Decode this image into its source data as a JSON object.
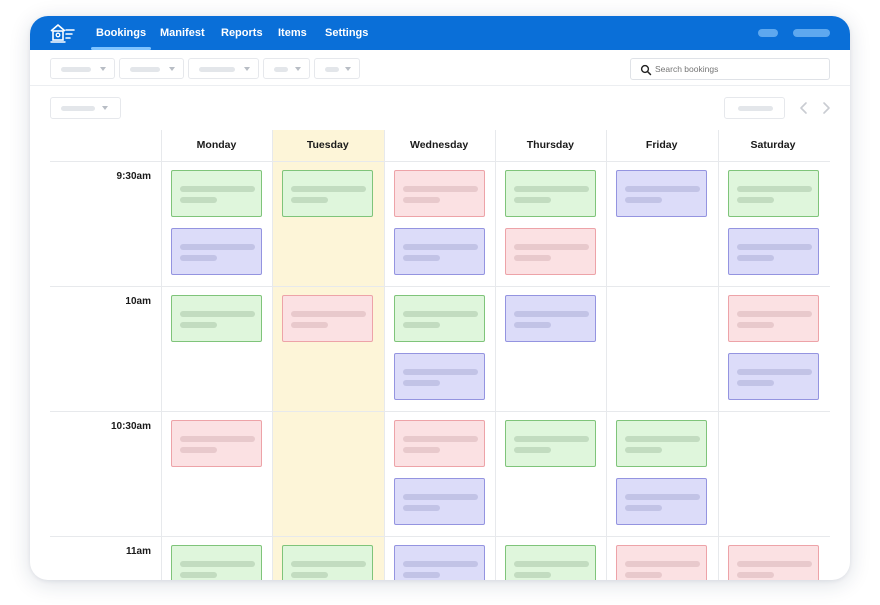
{
  "nav": {
    "items": [
      {
        "label": "Bookings",
        "active": true
      },
      {
        "label": "Manifest",
        "active": false
      },
      {
        "label": "Reports",
        "active": false
      },
      {
        "label": "Items",
        "active": false
      },
      {
        "label": "Settings",
        "active": false
      }
    ]
  },
  "search": {
    "placeholder": "Search bookings",
    "icon": "search-icon"
  },
  "calendar": {
    "days": [
      "Monday",
      "Tuesday",
      "Wednesday",
      "Thursday",
      "Friday",
      "Saturday"
    ],
    "highlighted_day": "Tuesday",
    "times": [
      "9:30am",
      "10am",
      "10:30am",
      "11am"
    ],
    "bookings": {
      "9:30am": {
        "Monday": [
          "green",
          "blue"
        ],
        "Tuesday": [
          "green"
        ],
        "Wednesday": [
          "red",
          "blue"
        ],
        "Thursday": [
          "green",
          "red"
        ],
        "Friday": [
          "blue"
        ],
        "Saturday": [
          "green",
          "blue"
        ]
      },
      "10am": {
        "Monday": [
          "green"
        ],
        "Tuesday": [
          "red"
        ],
        "Wednesday": [
          "green",
          "blue"
        ],
        "Thursday": [
          "blue"
        ],
        "Friday": [],
        "Saturday": [
          "red",
          "blue"
        ]
      },
      "10:30am": {
        "Monday": [
          "red"
        ],
        "Tuesday": [],
        "Wednesday": [
          "red",
          "blue"
        ],
        "Thursday": [
          "green"
        ],
        "Friday": [
          "green",
          "blue"
        ],
        "Saturday": []
      },
      "11am": {
        "Monday": [
          "green"
        ],
        "Tuesday": [
          "green"
        ],
        "Wednesday": [
          "blue"
        ],
        "Thursday": [
          "green"
        ],
        "Friday": [
          "red"
        ],
        "Saturday": [
          "red"
        ]
      }
    }
  },
  "colors": {
    "topbar": "#0a6fd8",
    "highlight": "#fdf5d8",
    "green": "#dff6dc",
    "red": "#fbe1e3",
    "blue": "#dcdcf9"
  }
}
